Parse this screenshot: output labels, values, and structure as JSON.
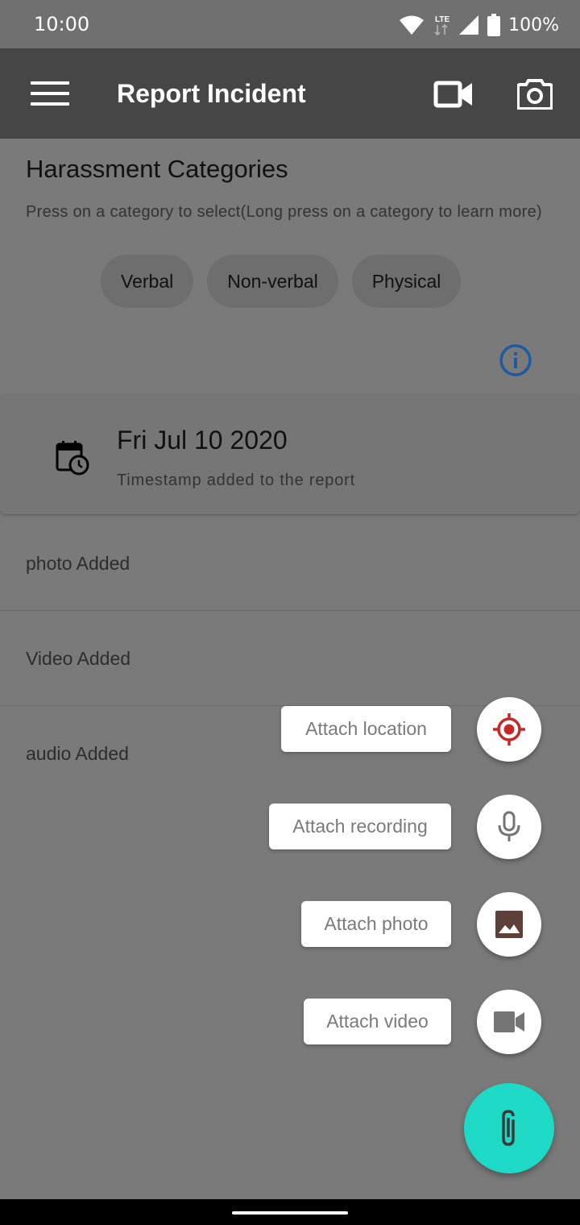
{
  "status_bar": {
    "time": "10:00",
    "network": "LTE",
    "battery": "100%"
  },
  "app_bar": {
    "title": "Report Incident",
    "icons": [
      "menu-icon",
      "video-camera-icon",
      "camera-icon"
    ]
  },
  "categories": {
    "title": "Harassment Categories",
    "hint": "Press on a category to select(Long press on a category to learn more)",
    "chips": [
      "Verbal",
      "Non-verbal",
      "Physical"
    ]
  },
  "timestamp_card": {
    "date": "Fri Jul 10 2020",
    "subtitle": "Timestamp added to the report"
  },
  "attachments": [
    "photo Added",
    "Video Added",
    "audio Added"
  ],
  "fab_menu": {
    "items": [
      {
        "label": "Attach location",
        "icon": "location-target-icon"
      },
      {
        "label": "Attach recording",
        "icon": "microphone-icon"
      },
      {
        "label": "Attach photo",
        "icon": "image-icon"
      },
      {
        "label": "Attach video",
        "icon": "video-icon"
      }
    ],
    "main_icon": "paperclip-icon"
  },
  "colors": {
    "app_bar": "#464646",
    "fab": "#1dd9c5",
    "info_icon": "#1e5aa0",
    "location_icon": "#c62828",
    "image_icon": "#5d4037"
  }
}
